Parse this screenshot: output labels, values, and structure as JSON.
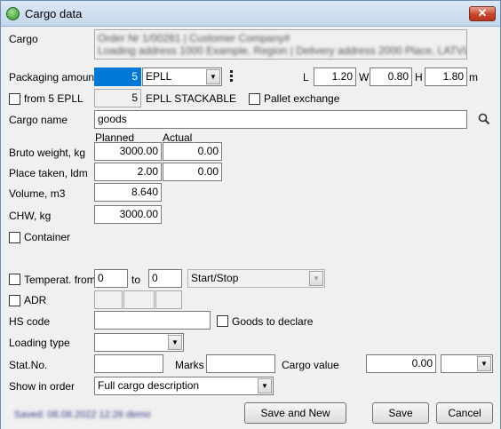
{
  "window": {
    "title": "Cargo data",
    "close_glyph": "✕"
  },
  "cargo": {
    "label": "Cargo",
    "desc_line1": "Order Nr 1/00281 | Customer Company#",
    "desc_line2": "Loading address 1000 Example, Region | Delivery address 2000 Place, LATVIA"
  },
  "packaging": {
    "label": "Packaging amount",
    "amount": "5",
    "type": "EPLL",
    "L_label": "L",
    "L": "1.20",
    "W_label": "W",
    "W": "0.80",
    "H_label": "H",
    "H": "1.80",
    "unit": "m"
  },
  "stackable": {
    "checkbox_label": "from 5 EPLL",
    "count": "5",
    "type": "EPLL STACKABLE",
    "pallet_exchange_label": "Pallet exchange"
  },
  "cargo_name": {
    "label": "Cargo name",
    "value": "goods"
  },
  "columns": {
    "planned": "Planned",
    "actual": "Actual"
  },
  "bruto": {
    "label": "Bruto weight, kg",
    "planned": "3000.00",
    "actual": "0.00"
  },
  "place": {
    "label": "Place taken, ldm",
    "planned": "2.00",
    "actual": "0.00"
  },
  "volume": {
    "label": "Volume, m3",
    "value": "8.640"
  },
  "chw": {
    "label": "CHW, kg",
    "value": "3000.00"
  },
  "container": {
    "label": "Container"
  },
  "temperature": {
    "label": "Temperat. from",
    "from": "0",
    "to_label": "to",
    "to": "0",
    "mode": "Start/Stop"
  },
  "adr": {
    "label": "ADR"
  },
  "hs": {
    "label": "HS code",
    "value": "",
    "goods_declare_label": "Goods to declare"
  },
  "loading": {
    "label": "Loading type",
    "value": ""
  },
  "stat": {
    "label": "Stat.No.",
    "value": "",
    "marks_label": "Marks",
    "marks_value": "",
    "cargo_value_label": "Cargo value",
    "cargo_value": "0.00",
    "currency": ""
  },
  "show_in_order": {
    "label": "Show in order",
    "value": "Full cargo description"
  },
  "status": {
    "text": "Saved: 08.08.2022 12:26 demo"
  },
  "buttons": {
    "save_and_new": "Save and New",
    "save": "Save",
    "cancel": "Cancel"
  },
  "colors": {
    "title_gradient_top": "#dce8f5",
    "selection": "#0078d7",
    "close_button": "#c9452c"
  },
  "icons": {
    "app": "app-globe-icon",
    "search": "search-icon",
    "more": "more-vertical-icon",
    "dropdown": "chevron-down-icon"
  }
}
